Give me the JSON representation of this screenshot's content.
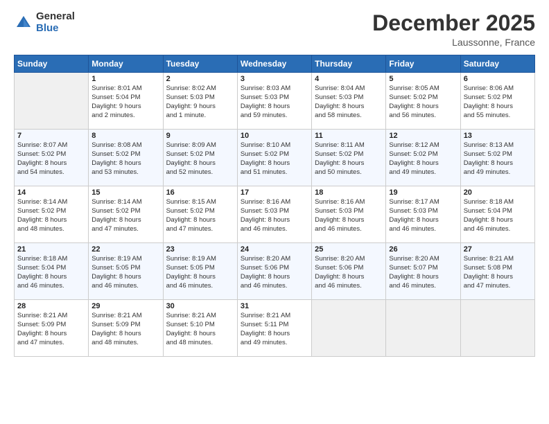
{
  "logo": {
    "general": "General",
    "blue": "Blue"
  },
  "title": "December 2025",
  "location": "Laussonne, France",
  "headers": [
    "Sunday",
    "Monday",
    "Tuesday",
    "Wednesday",
    "Thursday",
    "Friday",
    "Saturday"
  ],
  "weeks": [
    [
      {
        "day": "",
        "info": ""
      },
      {
        "day": "1",
        "info": "Sunrise: 8:01 AM\nSunset: 5:04 PM\nDaylight: 9 hours\nand 2 minutes."
      },
      {
        "day": "2",
        "info": "Sunrise: 8:02 AM\nSunset: 5:03 PM\nDaylight: 9 hours\nand 1 minute."
      },
      {
        "day": "3",
        "info": "Sunrise: 8:03 AM\nSunset: 5:03 PM\nDaylight: 8 hours\nand 59 minutes."
      },
      {
        "day": "4",
        "info": "Sunrise: 8:04 AM\nSunset: 5:03 PM\nDaylight: 8 hours\nand 58 minutes."
      },
      {
        "day": "5",
        "info": "Sunrise: 8:05 AM\nSunset: 5:02 PM\nDaylight: 8 hours\nand 56 minutes."
      },
      {
        "day": "6",
        "info": "Sunrise: 8:06 AM\nSunset: 5:02 PM\nDaylight: 8 hours\nand 55 minutes."
      }
    ],
    [
      {
        "day": "7",
        "info": "Sunrise: 8:07 AM\nSunset: 5:02 PM\nDaylight: 8 hours\nand 54 minutes."
      },
      {
        "day": "8",
        "info": "Sunrise: 8:08 AM\nSunset: 5:02 PM\nDaylight: 8 hours\nand 53 minutes."
      },
      {
        "day": "9",
        "info": "Sunrise: 8:09 AM\nSunset: 5:02 PM\nDaylight: 8 hours\nand 52 minutes."
      },
      {
        "day": "10",
        "info": "Sunrise: 8:10 AM\nSunset: 5:02 PM\nDaylight: 8 hours\nand 51 minutes."
      },
      {
        "day": "11",
        "info": "Sunrise: 8:11 AM\nSunset: 5:02 PM\nDaylight: 8 hours\nand 50 minutes."
      },
      {
        "day": "12",
        "info": "Sunrise: 8:12 AM\nSunset: 5:02 PM\nDaylight: 8 hours\nand 49 minutes."
      },
      {
        "day": "13",
        "info": "Sunrise: 8:13 AM\nSunset: 5:02 PM\nDaylight: 8 hours\nand 49 minutes."
      }
    ],
    [
      {
        "day": "14",
        "info": "Sunrise: 8:14 AM\nSunset: 5:02 PM\nDaylight: 8 hours\nand 48 minutes."
      },
      {
        "day": "15",
        "info": "Sunrise: 8:14 AM\nSunset: 5:02 PM\nDaylight: 8 hours\nand 47 minutes."
      },
      {
        "day": "16",
        "info": "Sunrise: 8:15 AM\nSunset: 5:02 PM\nDaylight: 8 hours\nand 47 minutes."
      },
      {
        "day": "17",
        "info": "Sunrise: 8:16 AM\nSunset: 5:03 PM\nDaylight: 8 hours\nand 46 minutes."
      },
      {
        "day": "18",
        "info": "Sunrise: 8:16 AM\nSunset: 5:03 PM\nDaylight: 8 hours\nand 46 minutes."
      },
      {
        "day": "19",
        "info": "Sunrise: 8:17 AM\nSunset: 5:03 PM\nDaylight: 8 hours\nand 46 minutes."
      },
      {
        "day": "20",
        "info": "Sunrise: 8:18 AM\nSunset: 5:04 PM\nDaylight: 8 hours\nand 46 minutes."
      }
    ],
    [
      {
        "day": "21",
        "info": "Sunrise: 8:18 AM\nSunset: 5:04 PM\nDaylight: 8 hours\nand 46 minutes."
      },
      {
        "day": "22",
        "info": "Sunrise: 8:19 AM\nSunset: 5:05 PM\nDaylight: 8 hours\nand 46 minutes."
      },
      {
        "day": "23",
        "info": "Sunrise: 8:19 AM\nSunset: 5:05 PM\nDaylight: 8 hours\nand 46 minutes."
      },
      {
        "day": "24",
        "info": "Sunrise: 8:20 AM\nSunset: 5:06 PM\nDaylight: 8 hours\nand 46 minutes."
      },
      {
        "day": "25",
        "info": "Sunrise: 8:20 AM\nSunset: 5:06 PM\nDaylight: 8 hours\nand 46 minutes."
      },
      {
        "day": "26",
        "info": "Sunrise: 8:20 AM\nSunset: 5:07 PM\nDaylight: 8 hours\nand 46 minutes."
      },
      {
        "day": "27",
        "info": "Sunrise: 8:21 AM\nSunset: 5:08 PM\nDaylight: 8 hours\nand 47 minutes."
      }
    ],
    [
      {
        "day": "28",
        "info": "Sunrise: 8:21 AM\nSunset: 5:09 PM\nDaylight: 8 hours\nand 47 minutes."
      },
      {
        "day": "29",
        "info": "Sunrise: 8:21 AM\nSunset: 5:09 PM\nDaylight: 8 hours\nand 48 minutes."
      },
      {
        "day": "30",
        "info": "Sunrise: 8:21 AM\nSunset: 5:10 PM\nDaylight: 8 hours\nand 48 minutes."
      },
      {
        "day": "31",
        "info": "Sunrise: 8:21 AM\nSunset: 5:11 PM\nDaylight: 8 hours\nand 49 minutes."
      },
      {
        "day": "",
        "info": ""
      },
      {
        "day": "",
        "info": ""
      },
      {
        "day": "",
        "info": ""
      }
    ]
  ]
}
